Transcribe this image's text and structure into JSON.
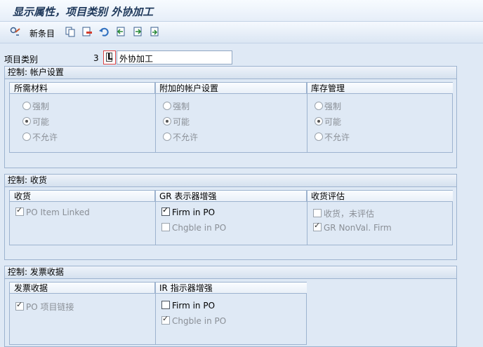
{
  "title": "显示属性，项目类别 外协加工",
  "toolbar": {
    "new_entries_label": "新条目"
  },
  "item_category": {
    "label": "项目类别",
    "code": "3",
    "code_letter": "L",
    "text": "外协加工"
  },
  "groups": {
    "account": {
      "title": "控制: 帐户设置",
      "columns": [
        {
          "header": "所需材料",
          "options": [
            "强制",
            "可能",
            "不允许"
          ],
          "selected": 1
        },
        {
          "header": "附加的帐户设置",
          "options": [
            "强制",
            "可能",
            "不允许"
          ],
          "selected": 1
        },
        {
          "header": "库存管理",
          "options": [
            "强制",
            "可能",
            "不允许"
          ],
          "selected": 1
        }
      ]
    },
    "gr": {
      "title": "控制: 收货",
      "columns": [
        {
          "header": "收货",
          "items": [
            {
              "label": "PO Item Linked",
              "checked": true,
              "enabled": false
            }
          ]
        },
        {
          "header": "GR 表示器增强",
          "items": [
            {
              "label": "Firm in PO",
              "checked": true,
              "enabled": true
            },
            {
              "label": "Chgble in PO",
              "checked": false,
              "enabled": false
            }
          ]
        },
        {
          "header": "收货评估",
          "items": [
            {
              "label": "收货，未评估",
              "checked": false,
              "enabled": false
            },
            {
              "label": "GR NonVal. Firm",
              "checked": true,
              "enabled": false
            }
          ]
        }
      ]
    },
    "ir": {
      "title": "控制: 发票收据",
      "columns": [
        {
          "header": "发票收据",
          "items": [
            {
              "label": "PO 项目链接",
              "checked": true,
              "enabled": false
            }
          ]
        },
        {
          "header": "IR 指示器增强",
          "items": [
            {
              "label": "Firm in PO",
              "checked": false,
              "enabled": true
            },
            {
              "label": "Chgble in PO",
              "checked": true,
              "enabled": false
            }
          ]
        }
      ]
    }
  }
}
